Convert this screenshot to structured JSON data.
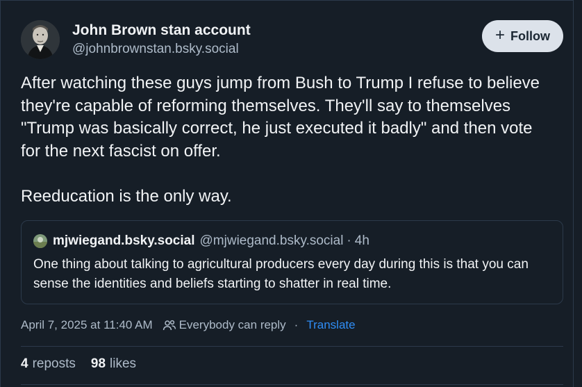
{
  "author": {
    "display_name": "John Brown stan account",
    "handle": "@johnbrownstan.bsky.social"
  },
  "follow_button": {
    "label": "Follow",
    "icon": "plus-icon"
  },
  "post": {
    "text": "After watching these guys jump from Bush to Trump I refuse to believe they're capable of reforming themselves. They'll say to themselves \"Trump was basically correct, he just executed it badly\" and then vote for the next fascist on offer.\n\nReeducation is the only way."
  },
  "quote": {
    "display_name": "mjwiegand.bsky.social",
    "handle": "@mjwiegand.bsky.social",
    "separator": "·",
    "time": "4h",
    "text": "One thing about talking to agricultural producers every day during this is that you can sense the identities and beliefs starting to shatter in real time."
  },
  "meta": {
    "timestamp": "April 7, 2025 at 11:40 AM",
    "reply_setting": "Everybody can reply",
    "separator": "·",
    "translate": "Translate"
  },
  "stats": {
    "reposts_count": "4",
    "reposts_label": "reposts",
    "likes_count": "98",
    "likes_label": "likes"
  },
  "colors": {
    "background": "#161e27",
    "accent_link": "#2f8df5",
    "follow_button_bg": "#dce2ea"
  }
}
